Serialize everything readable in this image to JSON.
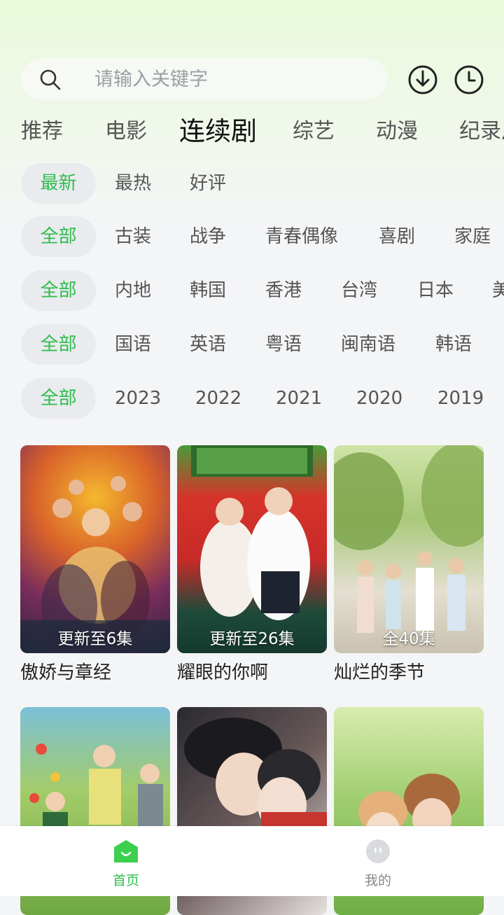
{
  "search": {
    "placeholder": "请输入关键字"
  },
  "icons": {
    "search": "search-icon",
    "download": "download-icon",
    "history": "history-clock-icon"
  },
  "colors": {
    "accent": "#2fbc4d",
    "top_bg": "#e9f9d9"
  },
  "tabs": [
    {
      "label": "推荐"
    },
    {
      "label": "电影"
    },
    {
      "label": "连续剧"
    },
    {
      "label": "综艺"
    },
    {
      "label": "动漫"
    },
    {
      "label": "纪录片"
    }
  ],
  "active_tab": "连续剧",
  "filters": {
    "sort": [
      "最新",
      "最热",
      "好评"
    ],
    "genre": [
      "全部",
      "古装",
      "战争",
      "青春偶像",
      "喜剧",
      "家庭"
    ],
    "region": [
      "全部",
      "内地",
      "韩国",
      "香港",
      "台湾",
      "日本",
      "美国"
    ],
    "language": [
      "全部",
      "国语",
      "英语",
      "粤语",
      "闽南语",
      "韩语"
    ],
    "year": [
      "全部",
      "2023",
      "2022",
      "2021",
      "2020",
      "2019"
    ]
  },
  "videos": [
    {
      "title": "傲娇与章经",
      "badge": "更新至6集"
    },
    {
      "title": "耀眼的你啊",
      "badge": "更新至26集"
    },
    {
      "title": "灿烂的季节",
      "badge": "全40集"
    },
    {
      "title": "",
      "badge": ""
    },
    {
      "title": "",
      "badge": ""
    },
    {
      "title": "",
      "badge": ""
    }
  ],
  "bottom_nav": [
    {
      "label": "首页",
      "icon": "home-icon",
      "active": true
    },
    {
      "label": "我的",
      "icon": "profile-icon",
      "active": false
    }
  ]
}
